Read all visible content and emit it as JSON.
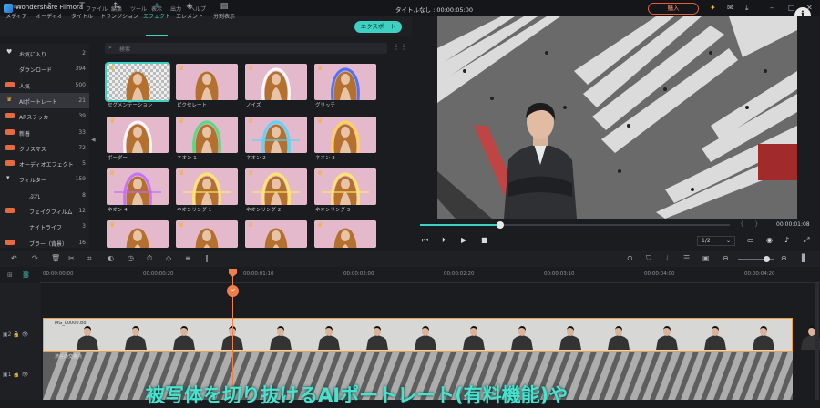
{
  "app": {
    "name": "Wondershare Filmora",
    "menu": [
      "ファイル",
      "編集",
      "ツール",
      "表示",
      "出力",
      "ヘルプ"
    ],
    "doc_title": "タイトルなし : 00:00:05:00",
    "buy": "購入"
  },
  "tabs": [
    {
      "label": "メディア",
      "icon": "folder-icon"
    },
    {
      "label": "オーディオ",
      "icon": "music-icon"
    },
    {
      "label": "タイトル",
      "icon": "text-icon"
    },
    {
      "label": "トランジション",
      "icon": "transition-icon"
    },
    {
      "label": "エフェクト",
      "icon": "effects-icon",
      "active": true
    },
    {
      "label": "エレメント",
      "icon": "element-icon"
    },
    {
      "label": "分割表示",
      "icon": "split-screen-icon"
    }
  ],
  "export_label": "エクスポート",
  "sidebar": [
    {
      "label": "お気に入り",
      "count": "2",
      "icon": "heart"
    },
    {
      "label": "ダウンロード",
      "count": "394"
    },
    {
      "label": "人気",
      "count": "500",
      "badge": true
    },
    {
      "label": "AIポートレート",
      "count": "21",
      "icon": "crown",
      "selected": true
    },
    {
      "label": "ARステッカー",
      "count": "39",
      "badge": true
    },
    {
      "label": "新着",
      "count": "33",
      "badge": true
    },
    {
      "label": "クリスマス",
      "count": "72",
      "badge": true
    },
    {
      "label": "オーディオエフェクト",
      "count": "5",
      "badge": true
    },
    {
      "label": "フィルター",
      "count": "159",
      "icon": "triangle"
    },
    {
      "label": "ぶれ",
      "count": "8",
      "indent": true
    },
    {
      "label": "フェイクフィルム",
      "count": "12",
      "badge": true,
      "indent": true
    },
    {
      "label": "ナイトライフ",
      "count": "3",
      "indent": true
    },
    {
      "label": "ブラー（背景）",
      "count": "16",
      "badge": true,
      "indent": true
    }
  ],
  "search": {
    "placeholder": "検索"
  },
  "effects": [
    {
      "label": "セグメンテーション",
      "glow": "none"
    },
    {
      "label": "ピクセレート",
      "glow": "none"
    },
    {
      "label": "ノイズ",
      "glow": "#ffffff"
    },
    {
      "label": "グリッチ",
      "glow": "#3a6cff"
    },
    {
      "label": "ボーダー",
      "glow": "#ffffff"
    },
    {
      "label": "ネオン 1",
      "glow": "#44e07a"
    },
    {
      "label": "ネオン 2",
      "glow": "#4bd8ff"
    },
    {
      "label": "ネオン 3",
      "glow": "#ffd54a"
    },
    {
      "label": "ネオン 4",
      "glow": "#c06cff"
    },
    {
      "label": "ネオンリング 1",
      "glow": "#ffe86a"
    },
    {
      "label": "ネオンリング 2",
      "glow": "#ffe86a"
    },
    {
      "label": "ネオンリング 3",
      "glow": "#ffe86a"
    },
    {
      "label": "",
      "glow": "none"
    },
    {
      "label": "",
      "glow": "none"
    },
    {
      "label": "",
      "glow": "none"
    },
    {
      "label": "",
      "glow": "none"
    }
  ],
  "player": {
    "timecode": "00:00:01:08",
    "quality": "1/2",
    "progress": 0.25
  },
  "ruler": [
    "00:00:00:00",
    "00:00:00:20",
    "00:00:01:10",
    "00:00:02:00",
    "00:00:02:20",
    "00:00:03:10",
    "00:00:04:00",
    "00:00:04:20"
  ],
  "tracks": {
    "video_clip": "MG_00000.bo",
    "background_clip": "渋谷の交差点"
  },
  "caption": "被写体を切り抜けるAIポートレート(有料機能)や"
}
